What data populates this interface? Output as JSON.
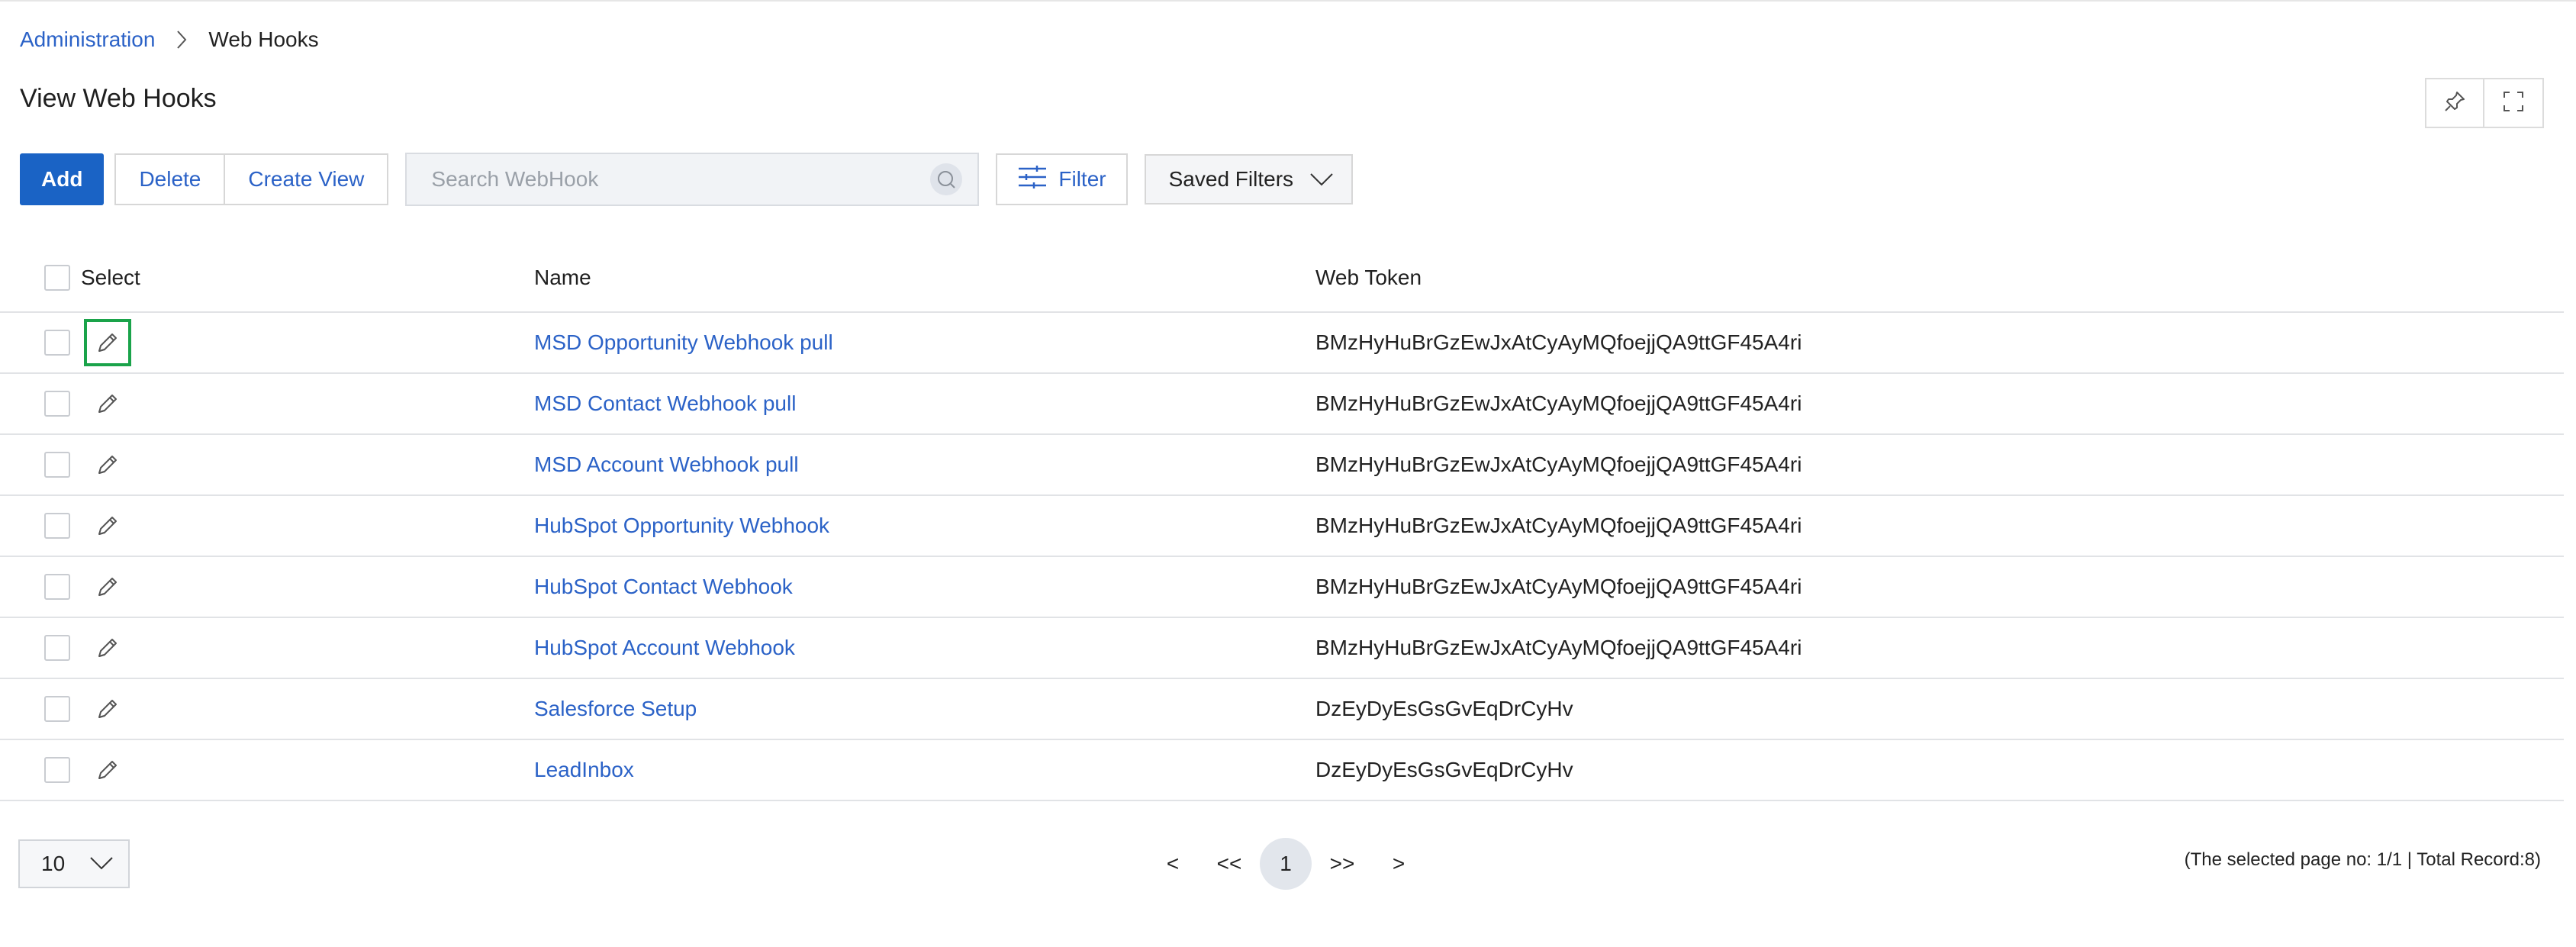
{
  "breadcrumb": {
    "parent": "Administration",
    "current": "Web Hooks"
  },
  "page": {
    "title": "View Web Hooks"
  },
  "toolbar": {
    "add_label": "Add",
    "delete_label": "Delete",
    "create_view_label": "Create View",
    "search_placeholder": "Search WebHook",
    "search_value": "",
    "filter_label": "Filter",
    "saved_filters_label": "Saved Filters"
  },
  "corner_icons": [
    "pin-icon",
    "fullscreen-icon"
  ],
  "table": {
    "columns": {
      "select": "Select",
      "name": "Name",
      "token": "Web Token"
    },
    "rows": [
      {
        "name": "MSD Opportunity Webhook pull",
        "token": "BMzHyHuBrGzEwJxAtCyAyMQfoejjQA9ttGF45A4ri",
        "focused": true
      },
      {
        "name": "MSD Contact Webhook pull",
        "token": "BMzHyHuBrGzEwJxAtCyAyMQfoejjQA9ttGF45A4ri"
      },
      {
        "name": "MSD Account Webhook pull",
        "token": "BMzHyHuBrGzEwJxAtCyAyMQfoejjQA9ttGF45A4ri"
      },
      {
        "name": "HubSpot Opportunity Webhook",
        "token": "BMzHyHuBrGzEwJxAtCyAyMQfoejjQA9ttGF45A4ri"
      },
      {
        "name": "HubSpot Contact Webhook",
        "token": "BMzHyHuBrGzEwJxAtCyAyMQfoejjQA9ttGF45A4ri"
      },
      {
        "name": "HubSpot Account Webhook",
        "token": "BMzHyHuBrGzEwJxAtCyAyMQfoejjQA9ttGF45A4ri"
      },
      {
        "name": "Salesforce Setup",
        "token": "DzEyDyEsGsGvEqDrCyHv"
      },
      {
        "name": "LeadInbox",
        "token": "DzEyDyEsGsGvEqDrCyHv"
      }
    ]
  },
  "pagination": {
    "page_size": "10",
    "prev": "<",
    "first": "<<",
    "current_page": "1",
    "last": ">>",
    "next": ">",
    "info": "(The selected page no: 1/1 | Total Record:8)"
  },
  "colors": {
    "accent": "#1a63c5",
    "link": "#2b62c7",
    "focus_outline": "#1aa34a"
  }
}
